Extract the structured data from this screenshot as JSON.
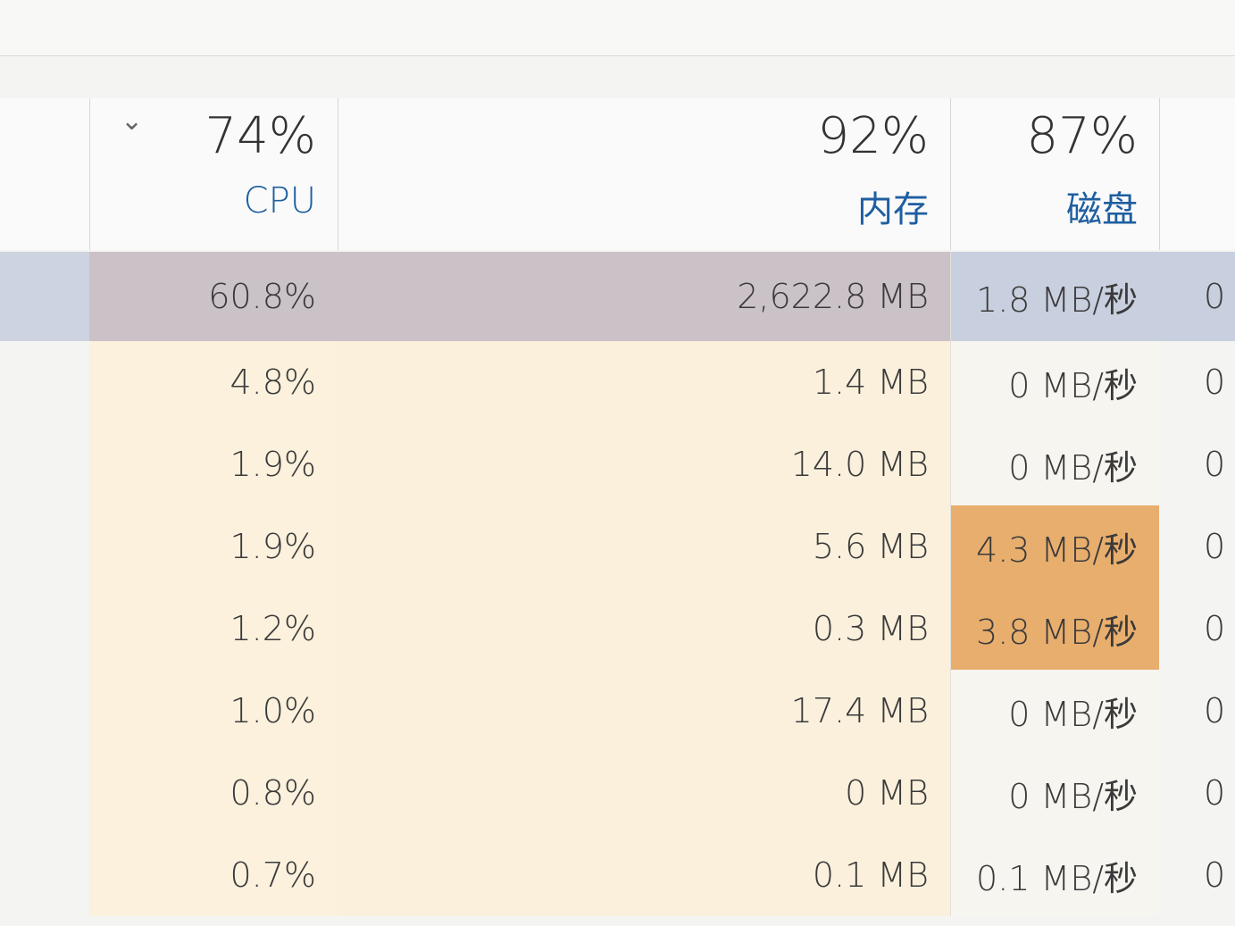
{
  "header": {
    "cpu": {
      "percent": "74%",
      "label": "CPU"
    },
    "memory": {
      "percent": "92%",
      "label": "内存"
    },
    "disk": {
      "percent": "87%",
      "label": "磁盘"
    }
  },
  "rows": [
    {
      "cpu": "60.8%",
      "memory": "2,622.8 MB",
      "disk": "1.8 MB/秒",
      "net": "0"
    },
    {
      "cpu": "4.8%",
      "memory": "1.4 MB",
      "disk": "0 MB/秒",
      "net": "0"
    },
    {
      "cpu": "1.9%",
      "memory": "14.0 MB",
      "disk": "0 MB/秒",
      "net": "0"
    },
    {
      "cpu": "1.9%",
      "memory": "5.6 MB",
      "disk": "4.3 MB/秒",
      "net": "0"
    },
    {
      "cpu": "1.2%",
      "memory": "0.3 MB",
      "disk": "3.8 MB/秒",
      "net": "0"
    },
    {
      "cpu": "1.0%",
      "memory": "17.4 MB",
      "disk": "0 MB/秒",
      "net": "0"
    },
    {
      "cpu": "0.8%",
      "memory": "0 MB",
      "disk": "0 MB/秒",
      "net": "0"
    },
    {
      "cpu": "0.7%",
      "memory": "0.1 MB",
      "disk": "0.1 MB/秒",
      "net": "0"
    }
  ],
  "colors": {
    "selected_row": "#cdd3e0",
    "heat_cell": "#e8ae6e",
    "column_tint": "#fbf1dd"
  },
  "icons": {
    "sort": "chevron-down-icon"
  }
}
